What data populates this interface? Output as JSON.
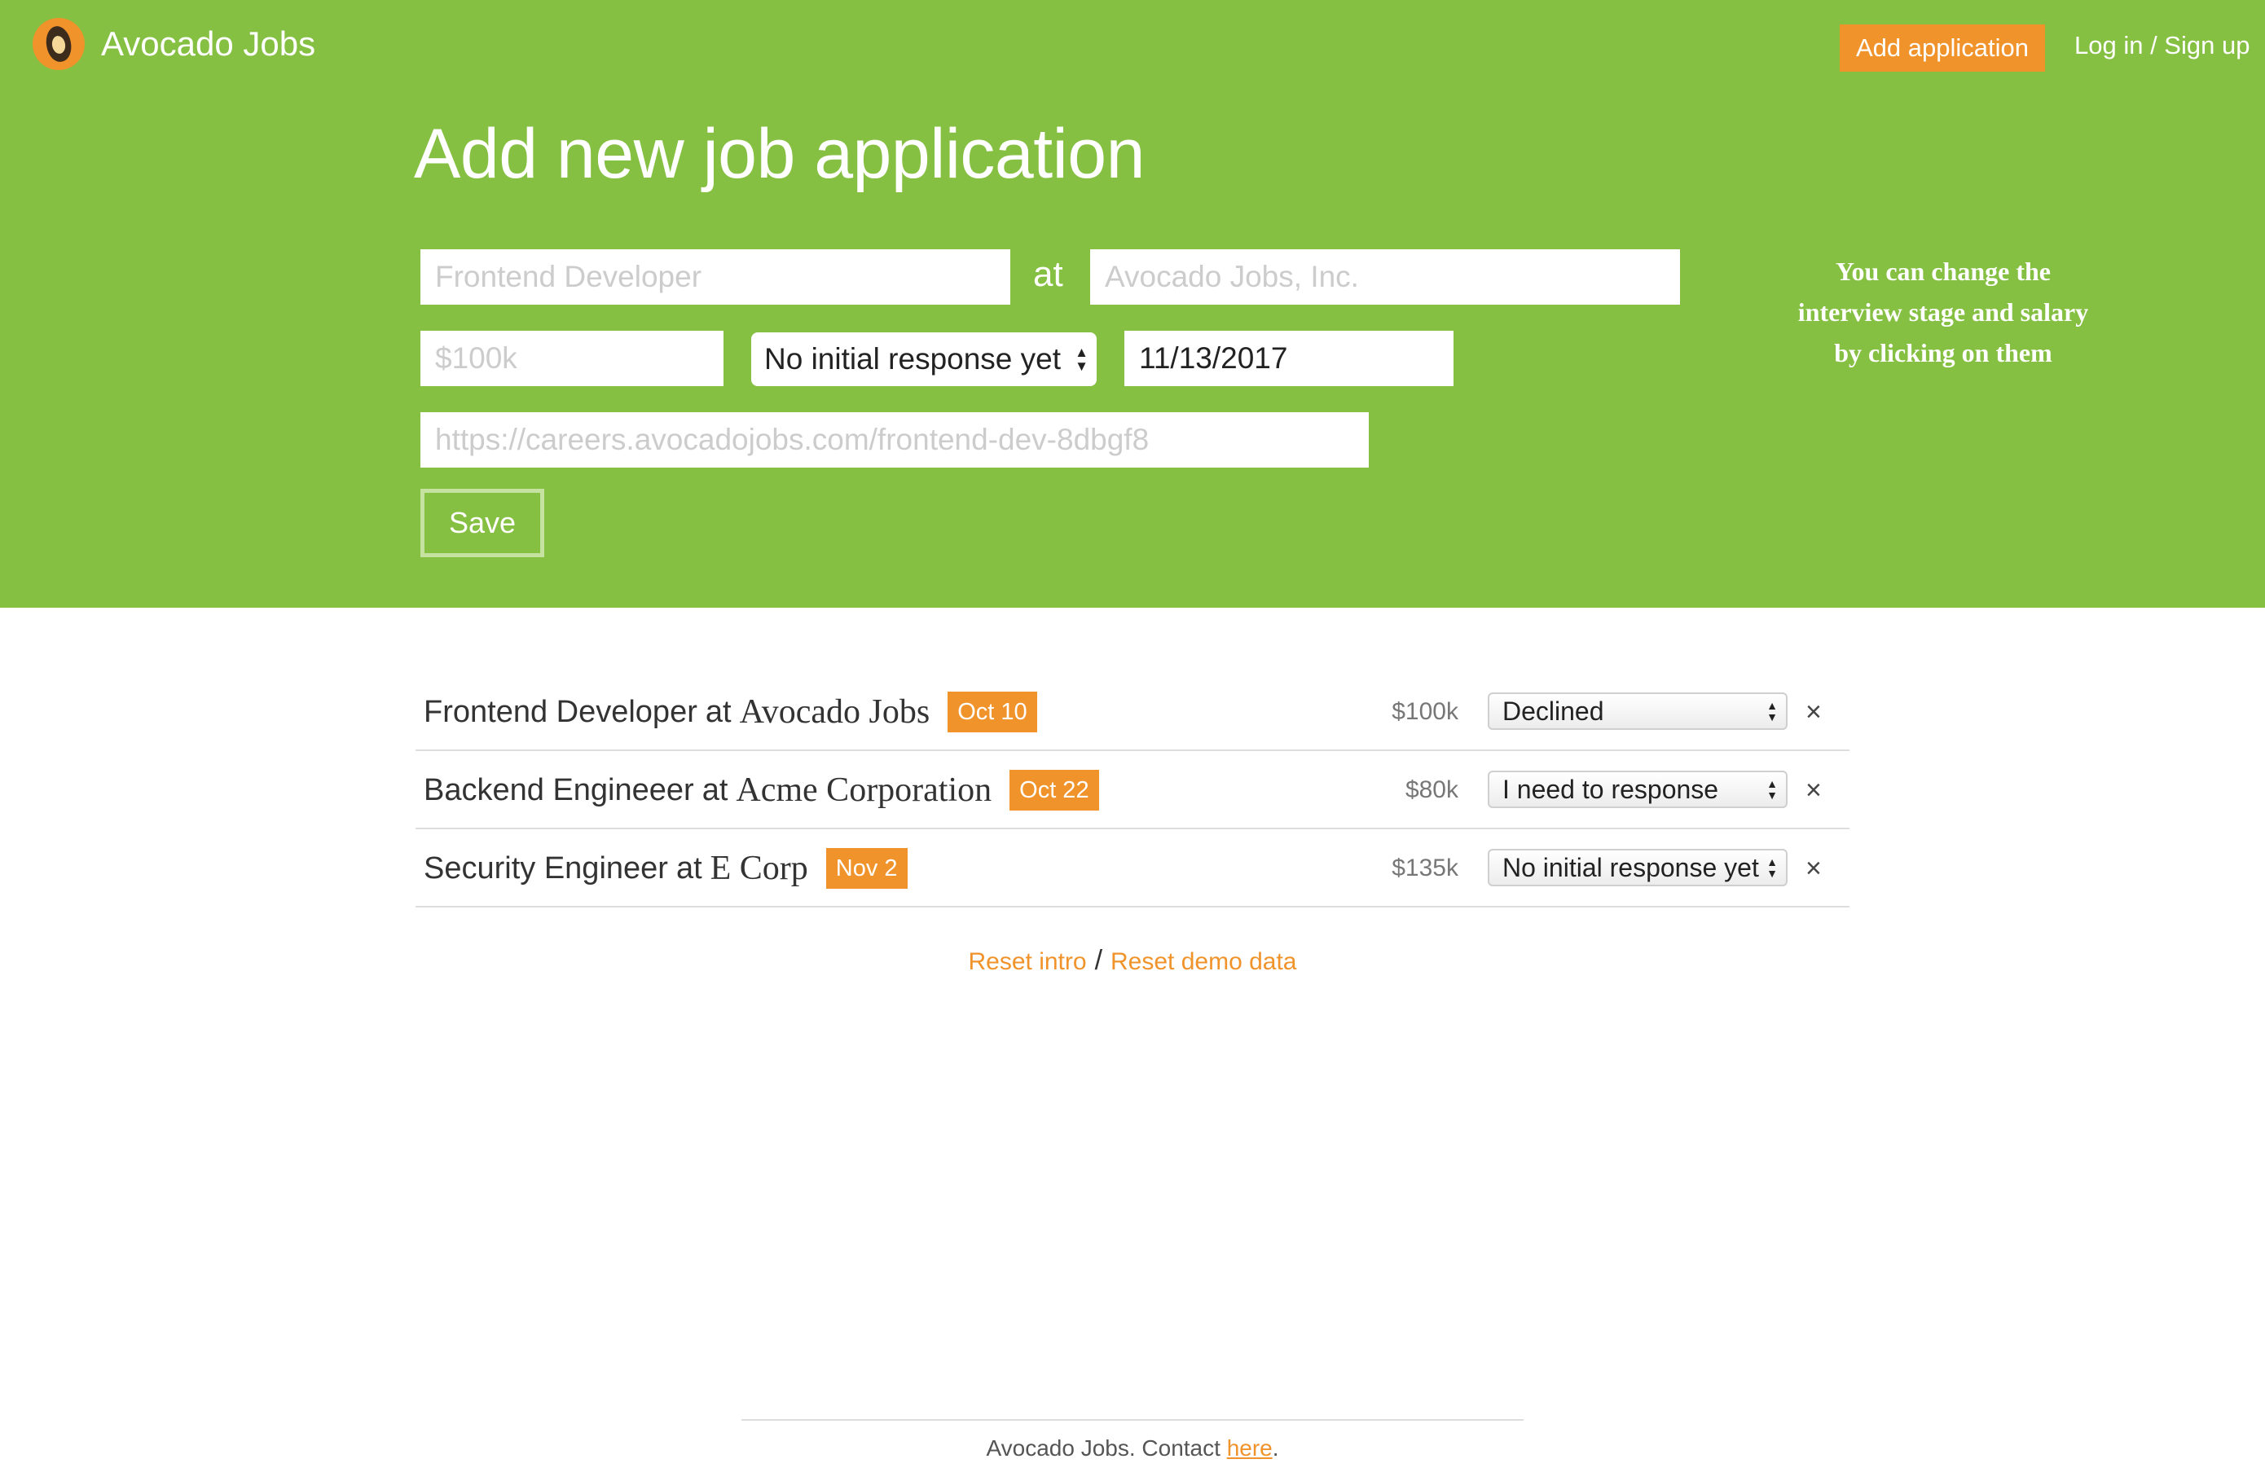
{
  "brand": {
    "name": "Avocado Jobs"
  },
  "nav": {
    "add_application": "Add application",
    "login": "Log in / Sign up"
  },
  "form": {
    "title": "Add new job application",
    "job_title_placeholder": "Frontend Developer",
    "at_label": "at",
    "company_placeholder": "Avocado Jobs, Inc.",
    "salary_placeholder": "$100k",
    "stage_value": "No initial response yet",
    "date_value": "11/13/2017",
    "url_placeholder": "https://careers.avocadojobs.com/frontend-dev-8dbgf8",
    "save_label": "Save"
  },
  "hint": "You can change the interview stage and salary by clicking on them",
  "applications": [
    {
      "title": "Frontend Developer",
      "at": "at",
      "company": "Avocado Jobs",
      "date": "Oct 10",
      "salary": "$100k",
      "stage": "Declined",
      "remove": "×"
    },
    {
      "title": "Backend Engineeer",
      "at": "at",
      "company": "Acme Corporation",
      "date": "Oct 22",
      "salary": "$80k",
      "stage": "I need to response",
      "remove": "×"
    },
    {
      "title": "Security Engineer",
      "at": "at",
      "company": "E Corp",
      "date": "Nov 2",
      "salary": "$135k",
      "stage": "No initial response yet",
      "remove": "×"
    }
  ],
  "links": {
    "reset_intro": "Reset intro",
    "separator": "/",
    "reset_demo": "Reset demo data"
  },
  "footer": {
    "text": "Avocado Jobs. Contact ",
    "contact_link": "here",
    "end": "."
  },
  "colors": {
    "hero_bg": "#86c043",
    "accent": "#f0932b"
  }
}
